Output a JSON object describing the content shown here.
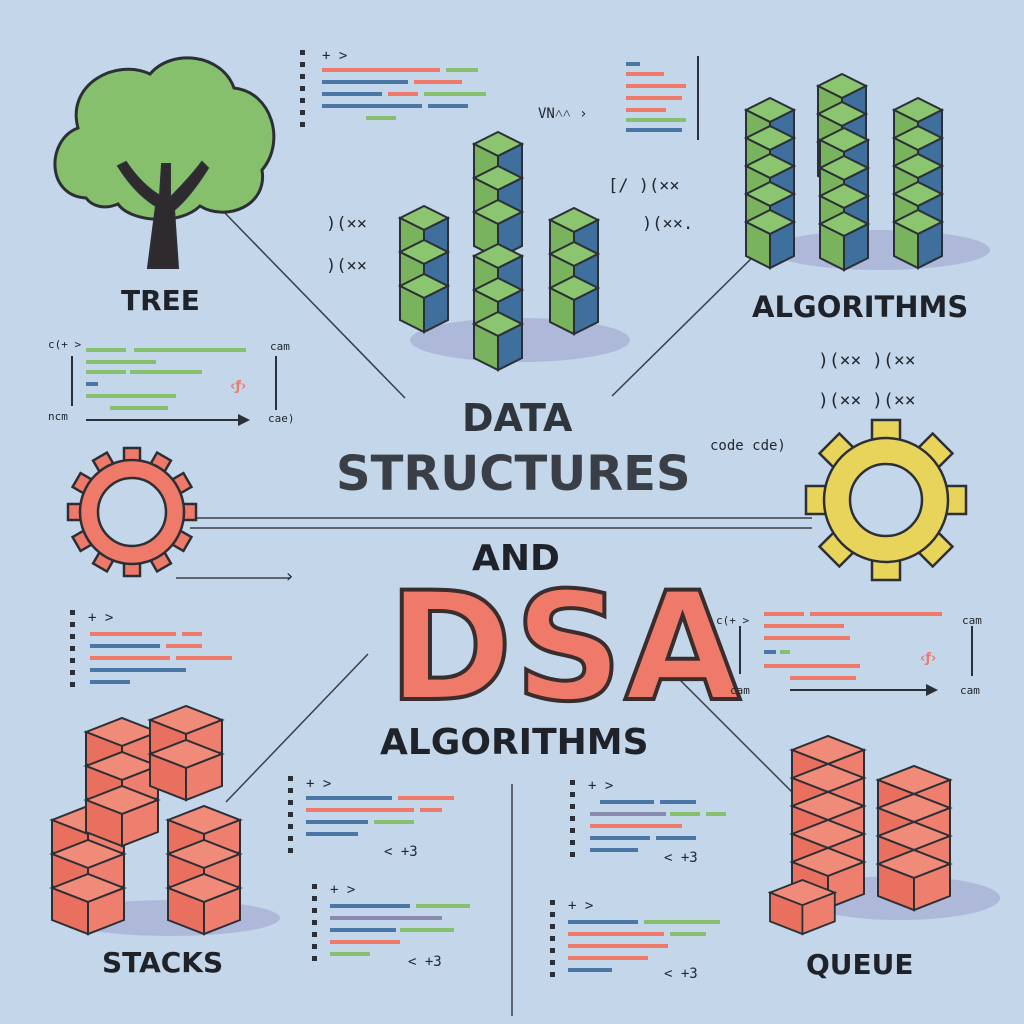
{
  "labels": {
    "tree": "TREE",
    "algorithms_top": "ALGORITHMS",
    "data": "DATA",
    "structures": "STRUCTURES",
    "and": "AND",
    "dsa": "DSA",
    "algorithms_bottom": "ALGORITHMS",
    "stacks": "STACKS",
    "queue": "QUEUE"
  },
  "code_glyphs": {
    "vn": "VN˄˄ ›",
    "fxxx": "[/ )(⨯⨯",
    "xxx_a": ")(⨯⨯",
    "xxx_b": ")(⨯⨯",
    "xxx_c": ")(⨯⨯.",
    "xxx_r1": ")(⨯⨯   )(⨯⨯",
    "xxx_r2": ")(⨯⨯   )(⨯⨯",
    "code_cde": "code cde)",
    "cplus_a": "c(+ >",
    "cam_a": "cam",
    "ncm_a": "ncm",
    "cae_a": "cae)",
    "cplus_b": "c(+ >",
    "cam_b": "cam",
    "cam_c": "cam",
    "cam_d": "cam",
    "lt_a": "< +3",
    "lt_b": "< +3",
    "lt_c": "< +3",
    "lt_d": "< +3",
    "arrow_glyph": "›"
  },
  "colors": {
    "background": "#c3d6ea",
    "green": "#86c06c",
    "blue": "#4a77a6",
    "coral": "#ef7a6a",
    "yellow": "#e9d45b",
    "outline": "#2c2f36"
  }
}
